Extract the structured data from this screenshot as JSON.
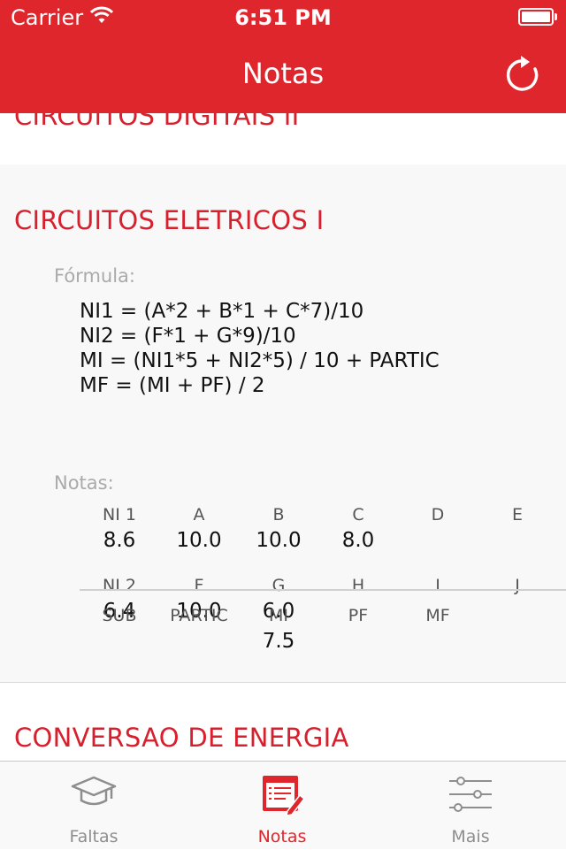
{
  "status_bar": {
    "carrier": "Carrier",
    "time": "6:51 PM"
  },
  "nav": {
    "title": "Notas",
    "refresh_icon": "refresh-icon"
  },
  "courses": {
    "previous": {
      "title": "CIRCUITOS DIGITAIS II"
    },
    "current": {
      "title": "CIRCUITOS ELETRICOS I",
      "formula_label": "Fórmula:",
      "formula_lines": [
        "NI1  = (A*2 + B*1 + C*7)/10",
        "NI2  = (F*1 + G*9)/10",
        "MI = (NI1*5 + NI2*5) / 10 + PARTIC",
        "MF = (MI + PF) / 2"
      ],
      "grades_label": "Notas:",
      "row1": {
        "headers": [
          "NI 1",
          "A",
          "B",
          "C",
          "D",
          "E"
        ],
        "values": [
          "8.6",
          "10.0",
          "10.0",
          "8.0",
          "",
          ""
        ]
      },
      "row2": {
        "headers": [
          "NI 2",
          "F",
          "G",
          "H",
          "I",
          "J"
        ],
        "values": [
          "6.4",
          "10.0",
          "6.0",
          "",
          "",
          ""
        ]
      },
      "row3": {
        "headers": [
          "SUB",
          "PARTIC",
          "MI",
          "PF",
          "MF"
        ],
        "values": [
          "",
          "",
          "7.5",
          "",
          ""
        ]
      }
    },
    "next": {
      "title": "CONVERSAO DE ENERGIA"
    }
  },
  "tabbar": {
    "tabs": [
      {
        "label": "Faltas",
        "icon": "graduation-cap-icon",
        "active": false
      },
      {
        "label": "Notas",
        "icon": "notes-icon",
        "active": true
      },
      {
        "label": "Mais",
        "icon": "sliders-icon",
        "active": false
      }
    ]
  },
  "colors": {
    "accent": "#e0262d",
    "course_title": "#d7202d"
  }
}
